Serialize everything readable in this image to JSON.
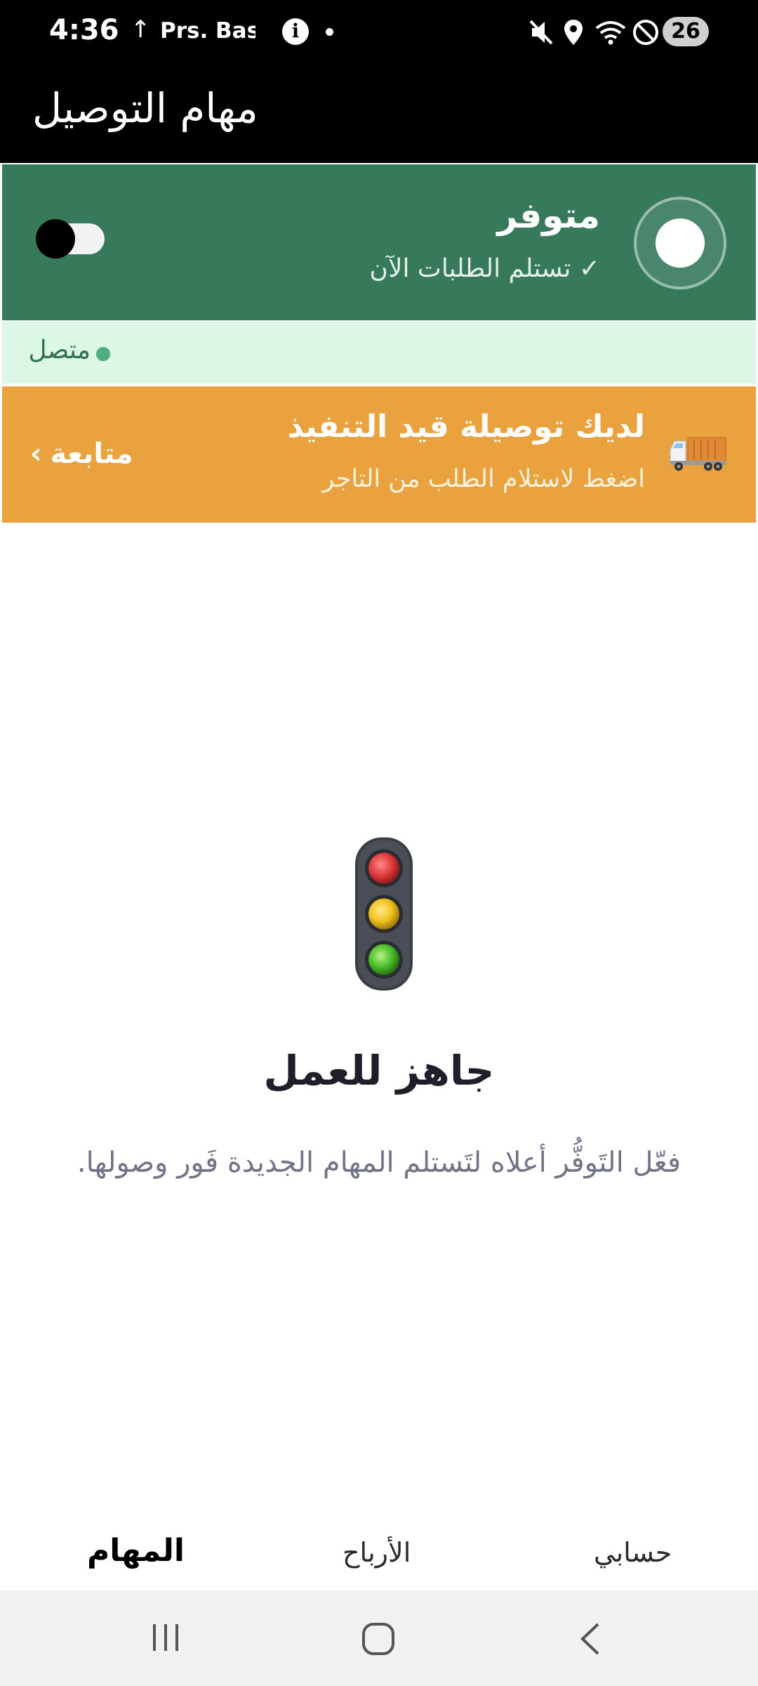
{
  "status_bar": {
    "time": "4:36",
    "carrier": "Prs. Basm",
    "info_glyph": "i",
    "battery": "26",
    "icons": [
      "upload-arrow-icon",
      "info-icon",
      "mute-icon",
      "location-icon",
      "wifi-icon",
      "do-not-disturb-icon"
    ]
  },
  "app_bar": {
    "title": "مهام التوصيل"
  },
  "availability": {
    "title": "متوفر",
    "subtitle": "✓ تستلم الطلبات الآن",
    "switch_on": false,
    "colors": {
      "background": "#36795b"
    }
  },
  "connection": {
    "label": "متصل",
    "dot_color": "#4caf7d"
  },
  "delivery_banner": {
    "title": "لديك توصيلة قيد التنفيذ",
    "subtitle": "اضغط لاستلام الطلب من التاجر",
    "action_label": "متابعة",
    "icon": "truck-icon",
    "colors": {
      "background": "#e9a23d"
    }
  },
  "empty_state": {
    "icon": "traffic-light-icon",
    "title": "جاهز للعمل",
    "description": "فعّل التَوفُّر أعلاه لتَستلم المهام الجديدة فَور وصولها."
  },
  "tabs": [
    {
      "label": "حسابي",
      "active": false
    },
    {
      "label": "الأرباح",
      "active": false
    },
    {
      "label": "المهام",
      "active": true
    }
  ],
  "system_nav": [
    "recents-icon",
    "home-icon",
    "back-icon"
  ]
}
